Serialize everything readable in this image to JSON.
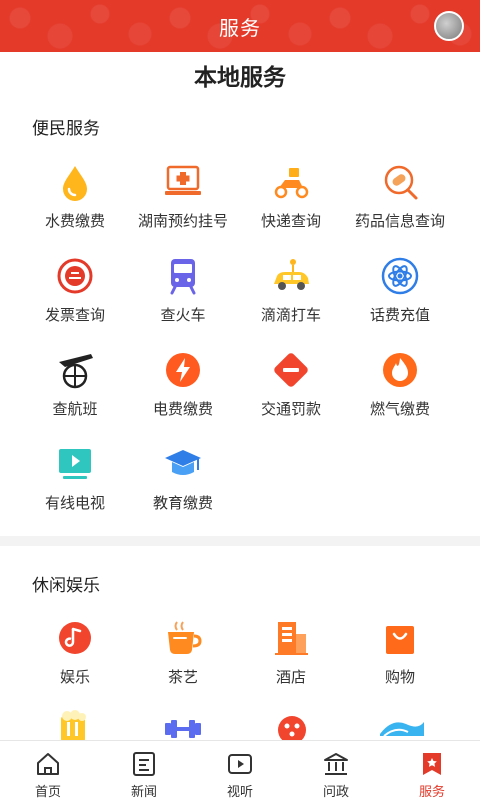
{
  "header": {
    "title": "服务"
  },
  "page_title": "本地服务",
  "sections": {
    "convenience": {
      "title": "便民服务",
      "items": [
        {
          "label": "水费缴费",
          "icon": "water-drop-icon"
        },
        {
          "label": "湖南预约挂号",
          "icon": "hospital-laptop-icon"
        },
        {
          "label": "快递查询",
          "icon": "scooter-icon"
        },
        {
          "label": "药品信息查询",
          "icon": "pill-search-icon"
        },
        {
          "label": "发票查询",
          "icon": "emblem-icon"
        },
        {
          "label": "查火车",
          "icon": "train-icon"
        },
        {
          "label": "滴滴打车",
          "icon": "car-icon"
        },
        {
          "label": "话费充值",
          "icon": "atom-icon"
        },
        {
          "label": "查航班",
          "icon": "plane-icon"
        },
        {
          "label": "电费缴费",
          "icon": "lightning-icon"
        },
        {
          "label": "交通罚款",
          "icon": "no-entry-icon"
        },
        {
          "label": "燃气缴费",
          "icon": "flame-icon"
        },
        {
          "label": "有线电视",
          "icon": "tv-play-icon"
        },
        {
          "label": "教育缴费",
          "icon": "graduation-cap-icon"
        }
      ]
    },
    "leisure": {
      "title": "休闲娱乐",
      "items": [
        {
          "label": "娱乐",
          "icon": "music-note-icon"
        },
        {
          "label": "茶艺",
          "icon": "tea-cup-icon"
        },
        {
          "label": "酒店",
          "icon": "hotel-building-icon"
        },
        {
          "label": "购物",
          "icon": "shopping-bag-icon"
        }
      ]
    }
  },
  "tabbar": {
    "items": [
      {
        "label": "首页",
        "icon": "home-icon"
      },
      {
        "label": "新闻",
        "icon": "news-icon"
      },
      {
        "label": "视听",
        "icon": "video-icon"
      },
      {
        "label": "问政",
        "icon": "government-icon"
      },
      {
        "label": "服务",
        "icon": "service-flag-icon"
      }
    ],
    "active": "服务"
  },
  "colors": {
    "brand_red": "#e43a2a",
    "accent_orange": "#ff8a1f",
    "accent_blue": "#4a79f5"
  }
}
